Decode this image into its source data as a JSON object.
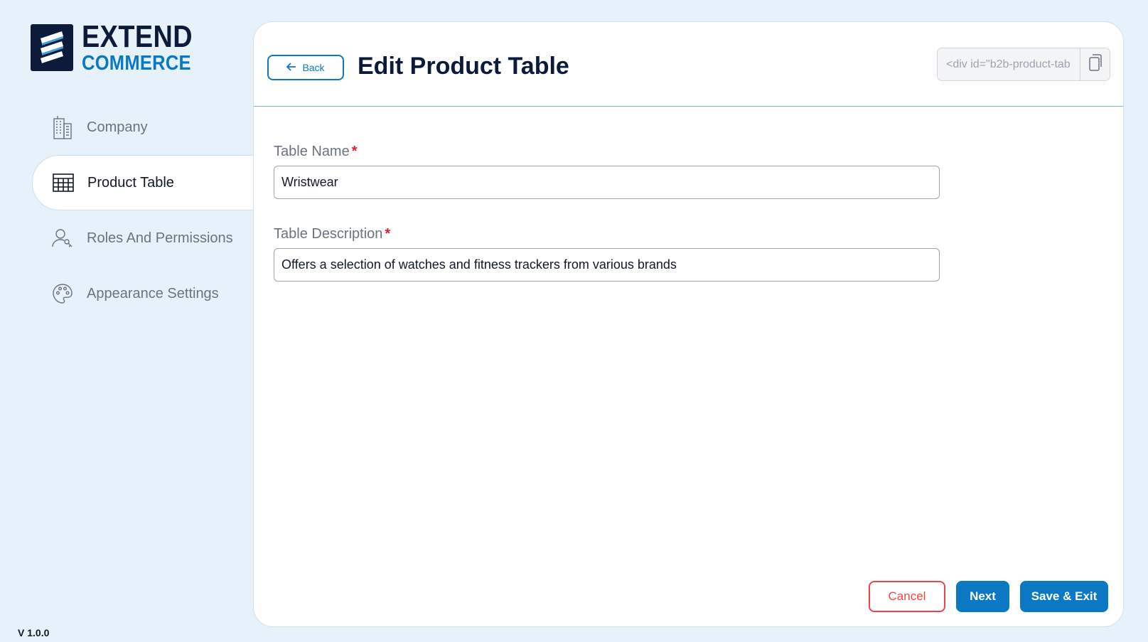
{
  "brand": {
    "name_top": "EXTEND",
    "name_bottom": "COMMERCE",
    "logo_icon": "extend-commerce-logo-icon"
  },
  "sidebar": {
    "items": [
      {
        "label": "Company",
        "icon": "building-icon",
        "active": false
      },
      {
        "label": "Product Table",
        "icon": "table-grid-icon",
        "active": true
      },
      {
        "label": "Roles And Permissions",
        "icon": "user-key-icon",
        "active": false
      },
      {
        "label": "Appearance Settings",
        "icon": "palette-icon",
        "active": false
      }
    ],
    "version": "V 1.0.0"
  },
  "header": {
    "back_label": "Back",
    "title": "Edit Product Table",
    "embed_code": "<div id=\"b2b-product-tab",
    "copy_icon": "copy-icon"
  },
  "form": {
    "table_name": {
      "label": "Table Name",
      "required_mark": "*",
      "value": "Wristwear"
    },
    "table_description": {
      "label": "Table Description",
      "required_mark": "*",
      "value": "Offers a selection of watches and fitness trackers from various brands"
    }
  },
  "actions": {
    "cancel_label": "Cancel",
    "next_label": "Next",
    "save_exit_label": "Save & Exit"
  },
  "colors": {
    "accent": "#0a78c2",
    "brand_dark": "#0c1b3a",
    "danger": "#ef4444",
    "background": "#e6f1fa"
  }
}
